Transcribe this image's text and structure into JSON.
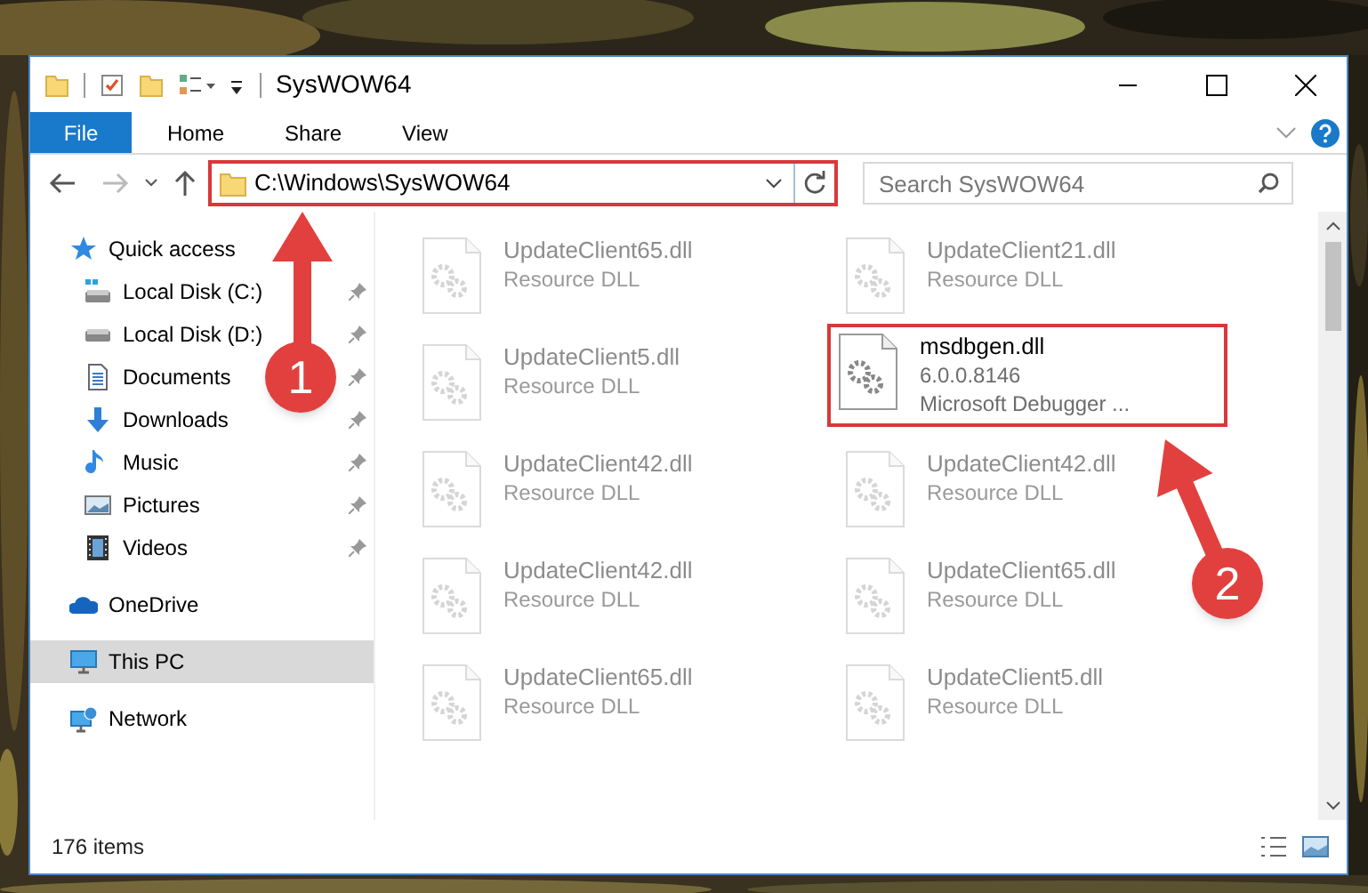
{
  "window": {
    "title": "SysWOW64"
  },
  "ribbon_tabs": [
    {
      "label": "File",
      "kind": "file"
    },
    {
      "label": "Home",
      "kind": "tab"
    },
    {
      "label": "Share",
      "kind": "tab"
    },
    {
      "label": "View",
      "kind": "tab"
    }
  ],
  "address_bar": {
    "path": "C:\\Windows\\SysWOW64",
    "highlighted": true
  },
  "search": {
    "placeholder": "Search SysWOW64"
  },
  "sidebar": {
    "items": [
      {
        "label": "Quick access",
        "kind": "star",
        "selected": false,
        "children": [
          {
            "label": "Local Disk (C:)",
            "kind": "system-drive",
            "pinned": true
          },
          {
            "label": "Local Disk (D:)",
            "kind": "drive",
            "pinned": true
          },
          {
            "label": "Documents",
            "kind": "documents",
            "pinned": true
          },
          {
            "label": "Downloads",
            "kind": "downloads",
            "pinned": true
          },
          {
            "label": "Music",
            "kind": "music",
            "pinned": true
          },
          {
            "label": "Pictures",
            "kind": "pictures",
            "pinned": true
          },
          {
            "label": "Videos",
            "kind": "videos",
            "pinned": true
          }
        ]
      },
      {
        "label": "OneDrive",
        "kind": "cloud",
        "selected": false
      },
      {
        "label": "This PC",
        "kind": "pc",
        "selected": true
      },
      {
        "label": "Network",
        "kind": "network",
        "selected": false
      }
    ]
  },
  "files": [
    {
      "name": "UpdateClient65.dll",
      "details": [
        "Resource DLL"
      ],
      "blurred": true,
      "highlighted": false
    },
    {
      "name": "UpdateClient21.dll",
      "details": [
        "Resource DLL"
      ],
      "blurred": true,
      "highlighted": false
    },
    {
      "name": "UpdateClient5.dll",
      "details": [
        "Resource DLL"
      ],
      "blurred": true,
      "highlighted": false
    },
    {
      "name": "msdbgen.dll",
      "details": [
        "6.0.0.8146",
        "Microsoft Debugger ..."
      ],
      "blurred": false,
      "highlighted": true
    },
    {
      "name": "UpdateClient42.dll",
      "details": [
        "Resource DLL"
      ],
      "blurred": true,
      "highlighted": false
    },
    {
      "name": "UpdateClient42.dll",
      "details": [
        "Resource DLL"
      ],
      "blurred": true,
      "highlighted": false
    },
    {
      "name": "UpdateClient42.dll",
      "details": [
        "Resource DLL"
      ],
      "blurred": true,
      "highlighted": false
    },
    {
      "name": "UpdateClient65.dll",
      "details": [
        "Resource DLL"
      ],
      "blurred": true,
      "highlighted": false
    },
    {
      "name": "UpdateClient65.dll",
      "details": [
        "Resource DLL"
      ],
      "blurred": true,
      "highlighted": false
    },
    {
      "name": "UpdateClient5.dll",
      "details": [
        "Resource DLL"
      ],
      "blurred": true,
      "highlighted": false
    }
  ],
  "status_bar": {
    "item_count": "176 items"
  },
  "annotations": [
    {
      "label": "1"
    },
    {
      "label": "2"
    }
  ]
}
